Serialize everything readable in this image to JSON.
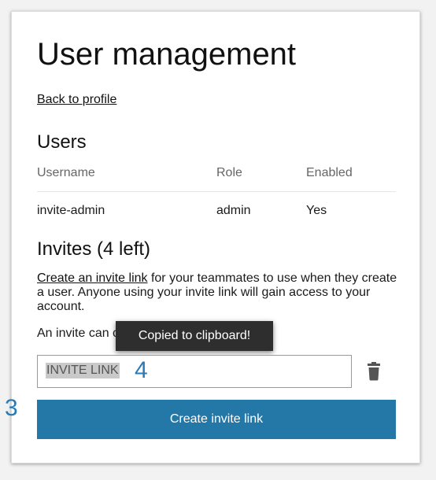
{
  "page": {
    "title": "User management",
    "back_link": "Back to profile"
  },
  "users": {
    "heading": "Users",
    "columns": [
      "Username",
      "Role",
      "Enabled"
    ],
    "rows": [
      {
        "username": "invite-admin",
        "role": "admin",
        "enabled": "Yes"
      }
    ]
  },
  "invites": {
    "heading": "Invites (4 left)",
    "link_text": "Create an invite link",
    "description_rest": " for your teammates to use when they create a user. Anyone using your invite link will gain access to your account.",
    "once_text": "An invite can c",
    "tooltip": "Copied to clipboard!",
    "input_value": "INVITE LINK",
    "create_button": "Create invite link"
  },
  "annotations": {
    "marker_input": "4",
    "marker_button": "3"
  },
  "colors": {
    "accent": "#2478a8",
    "marker": "#2a7ab6",
    "tooltip_bg": "#2e2e2e"
  },
  "icons": {
    "delete": "trash-icon"
  }
}
